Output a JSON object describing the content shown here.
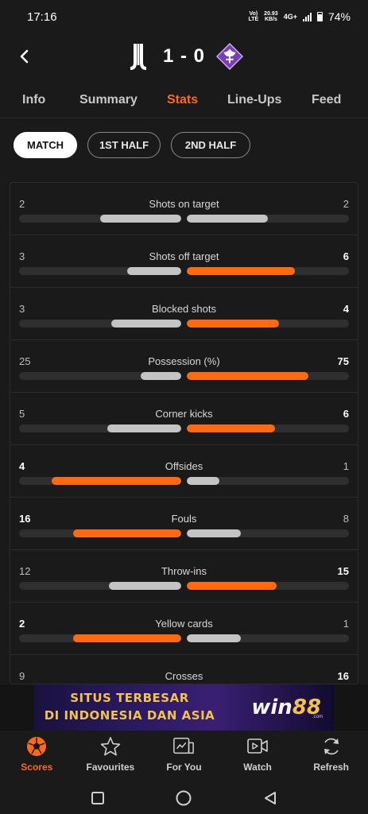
{
  "status_bar": {
    "time": "17:16",
    "network_type": "VoLTE",
    "speed_value": "20.93",
    "speed_unit": "KB/s",
    "net_gen": "4G+",
    "battery": "74%"
  },
  "header": {
    "home_team_icon": "juventus-crest-icon",
    "away_team_icon": "fiorentina-crest-icon",
    "score": "1 - 0"
  },
  "tabs": [
    {
      "label": "Info",
      "active": false
    },
    {
      "label": "Summary",
      "active": false
    },
    {
      "label": "Stats",
      "active": true
    },
    {
      "label": "Line-Ups",
      "active": false
    },
    {
      "label": "Feed",
      "active": false
    }
  ],
  "periods": [
    {
      "label": "MATCH",
      "active": true
    },
    {
      "label": "1ST HALF",
      "active": false
    },
    {
      "label": "2ND HALF",
      "active": false
    }
  ],
  "stats": [
    {
      "label": "Shots on target",
      "home": "2",
      "away": "2",
      "home_share": 0.5,
      "away_share": 0.5,
      "leader": "none"
    },
    {
      "label": "Shots off target",
      "home": "3",
      "away": "6",
      "home_share": 0.333,
      "away_share": 0.667,
      "leader": "away"
    },
    {
      "label": "Blocked shots",
      "home": "3",
      "away": "4",
      "home_share": 0.429,
      "away_share": 0.571,
      "leader": "away"
    },
    {
      "label": "Possession (%)",
      "home": "25",
      "away": "75",
      "home_share": 0.25,
      "away_share": 0.75,
      "leader": "away"
    },
    {
      "label": "Corner kicks",
      "home": "5",
      "away": "6",
      "home_share": 0.455,
      "away_share": 0.545,
      "leader": "away"
    },
    {
      "label": "Offsides",
      "home": "4",
      "away": "1",
      "home_share": 0.8,
      "away_share": 0.2,
      "leader": "home"
    },
    {
      "label": "Fouls",
      "home": "16",
      "away": "8",
      "home_share": 0.667,
      "away_share": 0.333,
      "leader": "home"
    },
    {
      "label": "Throw-ins",
      "home": "12",
      "away": "15",
      "home_share": 0.444,
      "away_share": 0.556,
      "leader": "away"
    },
    {
      "label": "Yellow cards",
      "home": "2",
      "away": "1",
      "home_share": 0.667,
      "away_share": 0.333,
      "leader": "home"
    },
    {
      "label": "Crosses",
      "home": "9",
      "away": "16",
      "home_share": 0.36,
      "away_share": 0.64,
      "leader": "away"
    }
  ],
  "ad": {
    "line1": "SITUS TERBESAR",
    "line2": "DI INDONESIA DAN ASIA",
    "brand_a": "win",
    "brand_b": "88",
    "domain": ".com"
  },
  "bottom_nav": [
    {
      "label": "Scores",
      "icon": "soccer-ball-icon",
      "active": true
    },
    {
      "label": "Favourites",
      "icon": "star-icon",
      "active": false
    },
    {
      "label": "For You",
      "icon": "for-you-icon",
      "active": false
    },
    {
      "label": "Watch",
      "icon": "video-play-icon",
      "active": false
    },
    {
      "label": "Refresh",
      "icon": "refresh-icon",
      "active": false
    }
  ],
  "colors": {
    "accent": "#ff6a1a",
    "bar_grey": "#c4c4c4",
    "background": "#1a1a1a"
  }
}
